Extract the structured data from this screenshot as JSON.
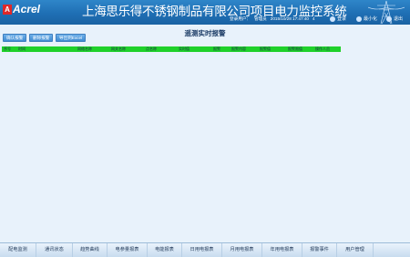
{
  "header": {
    "logo_mark": "A",
    "logo_text": "Acrel",
    "system_title": "上海思乐得不锈钢制品有限公司项目电力监控系统",
    "user_label": "登录用户：",
    "user_name": "管理员",
    "datetime": "2015/10/28  17:47:40",
    "weekday": "4"
  },
  "header_buttons": [
    {
      "label": "登录",
      "icon": "user-icon"
    },
    {
      "label": "最小化",
      "icon": "minimize-icon"
    },
    {
      "label": "退出",
      "icon": "exit-icon"
    }
  ],
  "page": {
    "title": "遥测实时报警"
  },
  "actions": [
    {
      "label": "确认报警"
    },
    {
      "label": "删除报警"
    },
    {
      "label": "导出到Excel"
    }
  ],
  "table": {
    "columns": [
      "序号",
      "时间",
      "网络名称",
      "网关名称",
      "点名称",
      "实时值",
      "报警",
      "报警内容",
      "报警值",
      "报警限值",
      "操作人员"
    ]
  },
  "bottom_nav": [
    "配电监测",
    "通讯状态",
    "趋势曲线",
    "电参量报表",
    "电能报表",
    "日用电报表",
    "月用电报表",
    "年用电报表",
    "报警事件",
    "用户管理"
  ],
  "colors": {
    "header_bg": "#1f6fb4",
    "table_header": "#1fd12a",
    "page_bg": "#e8f2fb"
  }
}
